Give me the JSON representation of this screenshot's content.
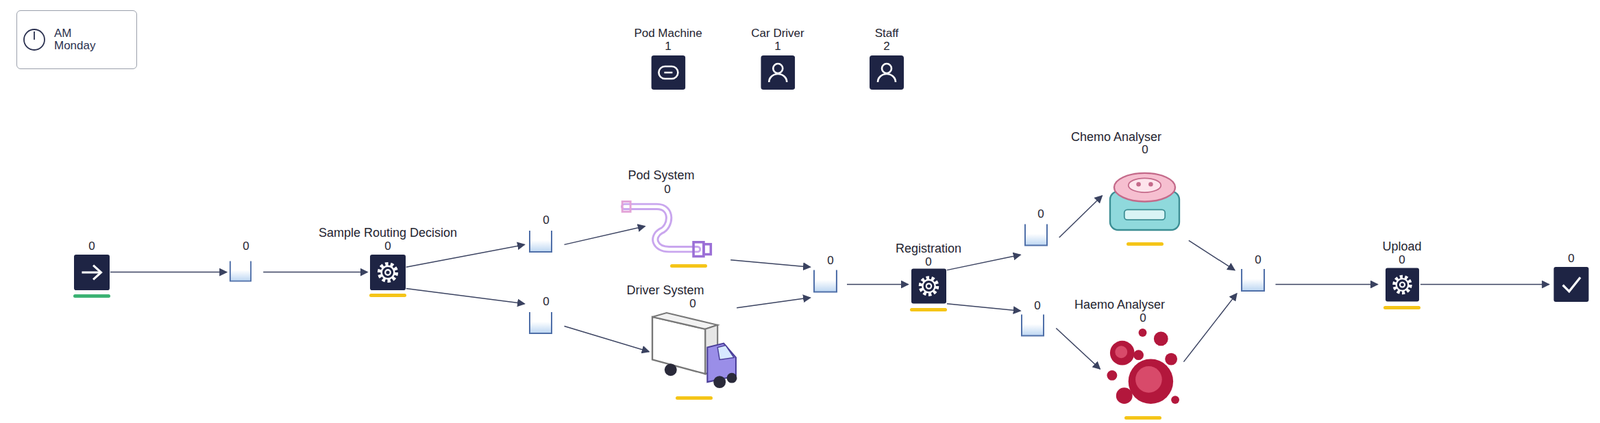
{
  "clock": {
    "period": "AM",
    "day": "Monday"
  },
  "resources": [
    {
      "label": "Pod Machine",
      "count": "1",
      "kind": "machine"
    },
    {
      "label": "Car Driver",
      "count": "1",
      "kind": "person"
    },
    {
      "label": "Staff",
      "count": "2",
      "kind": "person"
    }
  ],
  "nodes": [
    {
      "kind": "source",
      "count": "0",
      "color": "#3bb273"
    },
    {
      "kind": "queue",
      "count": "0"
    },
    {
      "kind": "activity",
      "label": "Sample Routing Decision",
      "count": "0",
      "color": "#f5c518"
    },
    {
      "kind": "queue",
      "count": "0"
    },
    {
      "kind": "queue",
      "count": "0"
    },
    {
      "kind": "pod",
      "label": "Pod System",
      "count": "0",
      "color": "#f5c518"
    },
    {
      "kind": "truck",
      "label": "Driver System",
      "count": "0",
      "color": "#f5c518"
    },
    {
      "kind": "queue",
      "count": "0"
    },
    {
      "kind": "activity",
      "label": "Registration",
      "count": "0",
      "color": "#f5c518"
    },
    {
      "kind": "queue",
      "count": "0"
    },
    {
      "kind": "queue",
      "count": "0"
    },
    {
      "kind": "chemo",
      "label": "Chemo Analyser",
      "count": "0",
      "color": "#f5c518"
    },
    {
      "kind": "haemo",
      "label": "Haemo Analyser",
      "count": "0",
      "color": "#f5c518"
    },
    {
      "kind": "queue",
      "count": "0"
    },
    {
      "kind": "activity",
      "label": "Upload",
      "count": "0",
      "color": "#f5c518"
    },
    {
      "kind": "sink",
      "count": "0"
    }
  ]
}
